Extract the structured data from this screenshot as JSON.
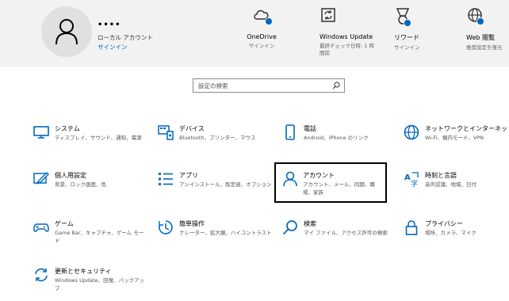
{
  "account": {
    "name": "••••",
    "type": "ローカル アカウント",
    "signin": "サインイン"
  },
  "quick": [
    {
      "title": "OneDrive",
      "sub": "サインイン",
      "icon": "cloud-icon"
    },
    {
      "title": "Windows Update",
      "sub": "最終チェック日時: 1 時間前",
      "icon": "update-icon"
    },
    {
      "title": "リワード",
      "sub": "サインイン",
      "icon": "rewards-icon"
    },
    {
      "title": "Web 閲覧",
      "sub": "推奨設定を復元",
      "icon": "globe-icon"
    }
  ],
  "search": {
    "placeholder": "設定の検索"
  },
  "categories": [
    {
      "title": "システム",
      "desc": "ディスプレイ、サウンド、通知、電源",
      "icon": "monitor-icon"
    },
    {
      "title": "デバイス",
      "desc": "Bluetooth、プリンター、マウス",
      "icon": "devices-icon"
    },
    {
      "title": "電話",
      "desc": "Android、iPhone のリンク",
      "icon": "phone-icon"
    },
    {
      "title": "ネットワークとインターネット",
      "desc": "Wi-Fi、機内モード、VPN",
      "icon": "globe-icon"
    },
    {
      "title": "個人用設定",
      "desc": "背景、ロック画面、色",
      "icon": "personalize-icon"
    },
    {
      "title": "アプリ",
      "desc": "アンインストール、既定値、オプション",
      "icon": "apps-icon"
    },
    {
      "title": "アカウント",
      "desc": "アカウント、メール、同期、職場、家族",
      "icon": "person-icon"
    },
    {
      "title": "時刻と言語",
      "desc": "音声認識、地域、日付",
      "icon": "time-language-icon"
    },
    {
      "title": "ゲーム",
      "desc": "Game Bar、キャプチャ、ゲーム モード",
      "icon": "gamepad-icon"
    },
    {
      "title": "簡単操作",
      "desc": "ナレーター、拡大鏡、ハイコントラスト",
      "icon": "ease-of-access-icon"
    },
    {
      "title": "検索",
      "desc": "マイ ファイル、アクセス許可の検索",
      "icon": "search-icon"
    },
    {
      "title": "プライバシー",
      "desc": "場所、カメラ、マイク",
      "icon": "lock-icon"
    },
    {
      "title": "更新とセキュリティ",
      "desc": "Windows Update、回復、バックアップ",
      "icon": "sync-icon"
    }
  ],
  "selected": "アカウント",
  "colors": {
    "accent": "#0067c0",
    "topbar": "#f2f2f2",
    "selected_border": "#000000"
  }
}
